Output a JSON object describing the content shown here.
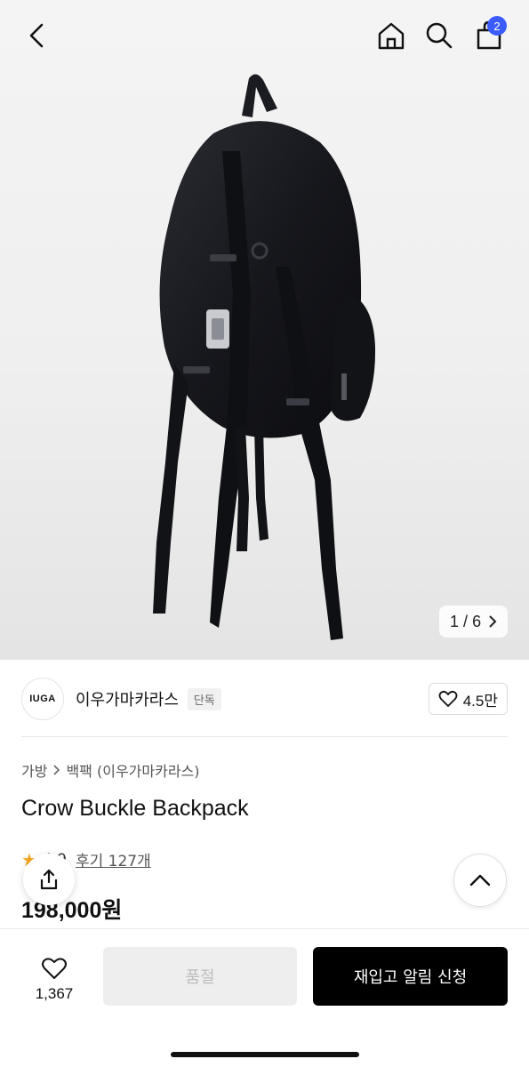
{
  "header": {
    "cart_count": "2"
  },
  "gallery": {
    "current": "1",
    "separator": "/",
    "total": "6",
    "next_icon": "chevron-right-icon"
  },
  "brand": {
    "logo_text": "IUGA",
    "name": "이우가마카라스",
    "tag": "단독",
    "likes": "4.5만"
  },
  "breadcrumb": {
    "category": "가방",
    "subcategory": "백팩 (이우가마카라스)"
  },
  "product": {
    "title": "Crow Buckle Backpack",
    "rating": "4.9",
    "reviews": "후기 127개",
    "price": "198,000원"
  },
  "bottom_bar": {
    "wish_count": "1,367",
    "soldout_label": "품절",
    "restock_label": "재입고 알림 신청"
  },
  "colors": {
    "accent": "#3b5bff",
    "star": "#f5a623",
    "primary_button": "#000000",
    "disabled_button": "#eeeeee"
  }
}
